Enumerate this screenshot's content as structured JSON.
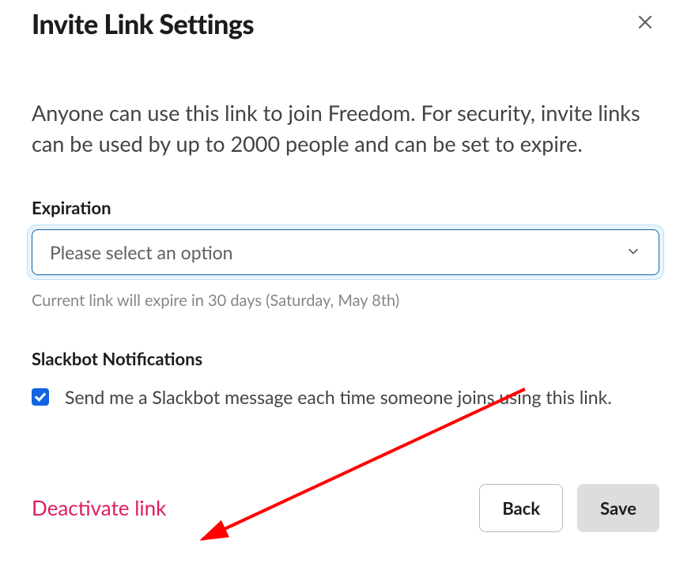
{
  "modal": {
    "title": "Invite Link Settings",
    "description": "Anyone can use this link to join Freedom. For security, invite links can be used by up to 2000 people and can be set to expire."
  },
  "expiration": {
    "label": "Expiration",
    "placeholder": "Please select an option",
    "helper": "Current link will expire in 30 days (Saturday, May 8th)"
  },
  "notifications": {
    "label": "Slackbot Notifications",
    "checkbox_label": "Send me a Slackbot message each time someone joins using this link.",
    "checked": true
  },
  "footer": {
    "deactivate": "Deactivate link",
    "back": "Back",
    "save": "Save"
  }
}
